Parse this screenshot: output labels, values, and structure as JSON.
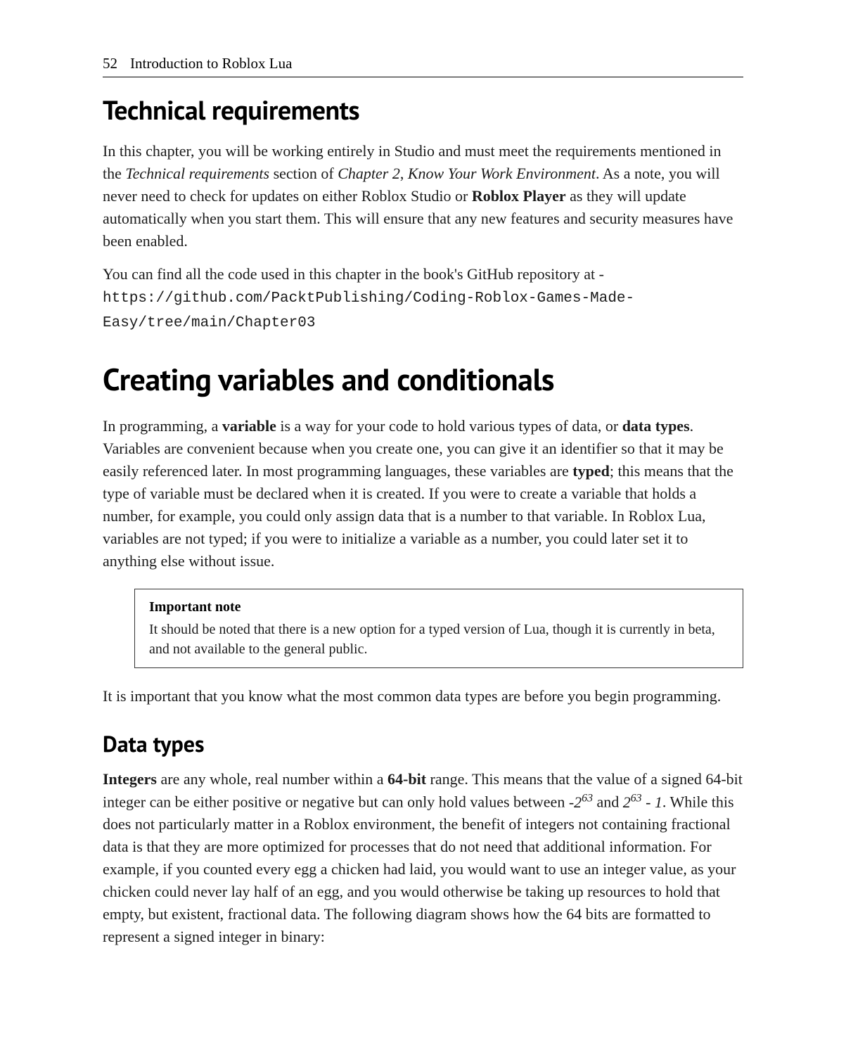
{
  "header": {
    "page_number": "52",
    "running_head": "Introduction to Roblox Lua"
  },
  "section1": {
    "title": "Technical requirements",
    "para1_part1": "In this chapter, you will be working entirely in Studio and must meet the requirements mentioned in the ",
    "para1_ital1": "Technical requirements",
    "para1_part2": " section of ",
    "para1_ital2": "Chapter 2",
    "para1_part3": ", ",
    "para1_ital3": "Know Your Work Environment",
    "para1_part4": ". As a note, you will never need to check for updates on either Roblox Studio or ",
    "para1_bold1": "Roblox Player",
    "para1_part5": " as they will update automatically when you start them. This will ensure that any new features and security measures have been enabled.",
    "para2_part1": "You can find all the code used in this chapter in the book's GitHub repository at - ",
    "para2_code": "https://github.com/PacktPublishing/Coding-Roblox-Games-Made-Easy/tree/main/Chapter03"
  },
  "section2": {
    "title": "Creating variables and conditionals",
    "para1_part1": "In programming, a ",
    "para1_bold1": "variable",
    "para1_part2": " is a way for your code to hold various types of data, or ",
    "para1_bold2": "data types",
    "para1_part3": ". Variables are convenient because when you create one, you can give it an identifier so that it may be easily referenced later. In most programming languages, these variables are ",
    "para1_bold3": "typed",
    "para1_part4": "; this means that the type of variable must be declared when it is created. If you were to create a variable that holds a number, for example, you could only assign data that is a number to that variable. In Roblox Lua, variables are not typed; if you were to initialize a variable as a number, you could later set it to anything else without issue.",
    "note": {
      "title": "Important note",
      "body": "It should be noted that there is a new option for a typed version of Lua, though it is currently in beta, and not available to the general public."
    },
    "para2": "It is important that you know what the most common data types are before you begin programming.",
    "subsec": {
      "title": "Data types",
      "para1_bold1": "Integers",
      "para1_part1": " are any whole, real number within a ",
      "para1_bold2": "64-bit",
      "para1_part2": " range. This means that the value of a signed 64-bit integer can be either positive or negative but can only hold values between ",
      "para1_mathdash": "-",
      "para1_mathbase1": "2",
      "para1_mathexp1": "63",
      "para1_mathand": " and ",
      "para1_mathbase2": "2",
      "para1_mathexp2": "63",
      "para1_mathmin": " - 1",
      "para1_part3": ". While this does not particularly matter in a Roblox environment, the benefit of integers not containing fractional data is that they are more optimized for processes that do not need that additional information. For example, if you counted every egg a chicken had laid, you would want to use an integer value, as your chicken could never lay half of an egg, and you would otherwise be taking up resources to hold that empty, but existent, fractional data. The following diagram shows how the 64 bits are formatted to represent a signed integer in binary:"
    }
  }
}
